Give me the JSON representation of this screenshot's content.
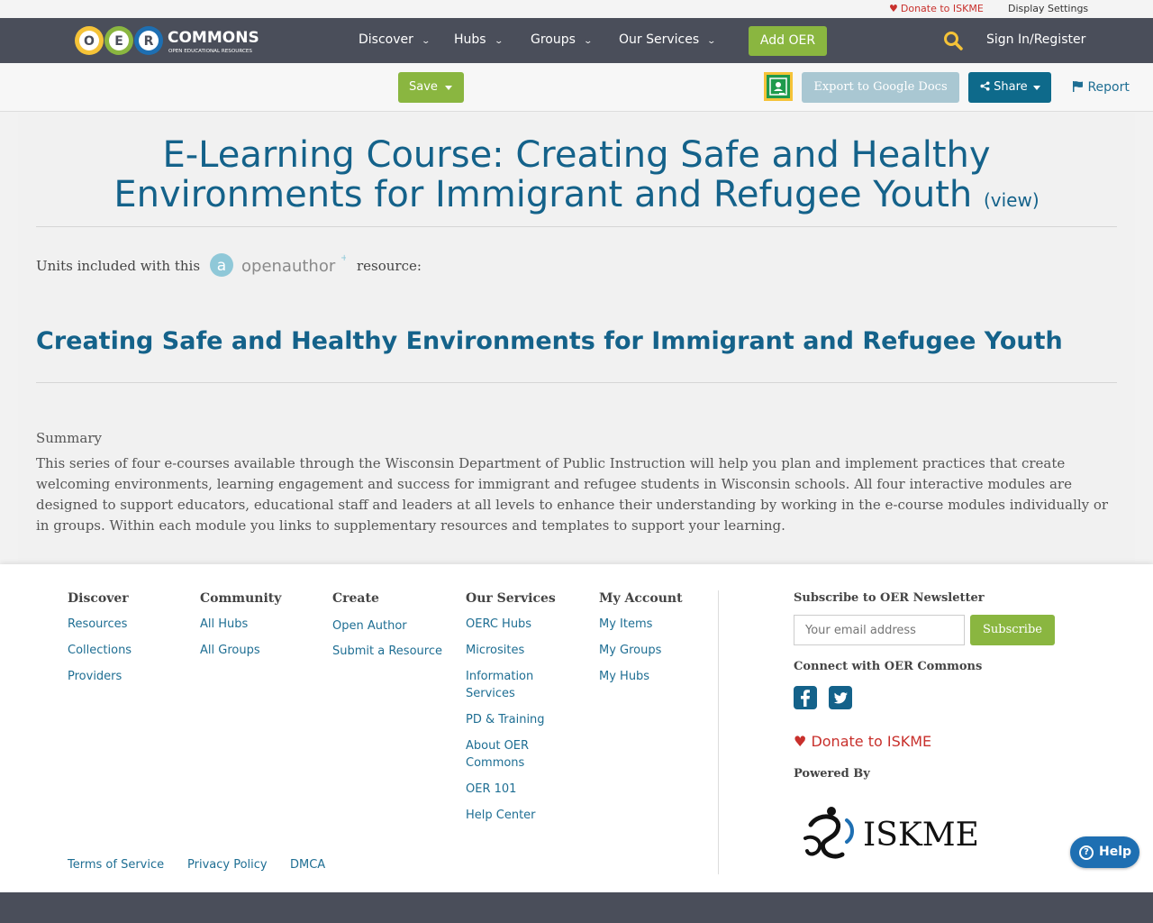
{
  "utility": {
    "donate": "Donate to ISKME",
    "display_settings": "Display Settings"
  },
  "nav": {
    "logo_letters": [
      "O",
      "E",
      "R"
    ],
    "logo_word": "COMMONS",
    "logo_tagline": "OPEN EDUCATIONAL RESOURCES",
    "items": [
      {
        "label": "Discover"
      },
      {
        "label": "Hubs"
      },
      {
        "label": "Groups"
      },
      {
        "label": "Our Services"
      }
    ],
    "add_oer": "Add OER",
    "sign_in": "Sign In/Register"
  },
  "toolbar": {
    "save": "Save",
    "export": "Export to Google Docs",
    "share": "Share",
    "report": "Report"
  },
  "main": {
    "title": "E-Learning Course: Creating Safe and Healthy Environments for Immigrant and Refugee Youth",
    "view_link": "(view)",
    "units_prefix": "Units included with this",
    "open_author_logo": "openauthor",
    "units_suffix": "resource:",
    "unit_title": "Creating Safe and Healthy Environments for Immigrant and Refugee Youth",
    "summary_label": "Summary",
    "summary_text": "This series of four e-courses available through the Wisconsin Department of Public Instruction will help you plan and implement practices that create welcoming environments, learning engagement and success for immigrant and refugee students in Wisconsin schools. All four interactive modules are designed to support educators, educational staff and leaders at all levels to enhance their understanding by working in the e-course modules individually or in groups. Within each module you links to supplementary resources and templates to support your learning."
  },
  "footer": {
    "columns": [
      {
        "heading": "Discover",
        "links": [
          "Resources",
          "Collections",
          "Providers"
        ]
      },
      {
        "heading": "Community",
        "links": [
          "All Hubs",
          "All Groups"
        ]
      },
      {
        "heading": "Create",
        "links": [
          "Open Author",
          "Submit a Resource"
        ]
      },
      {
        "heading": "Our Services",
        "links": [
          "OERC Hubs",
          "Microsites",
          "Information Services",
          "PD & Training",
          "About OER Commons",
          "OER 101",
          "Help Center"
        ]
      },
      {
        "heading": "My Account",
        "links": [
          "My Items",
          "My Groups",
          "My Hubs"
        ]
      }
    ],
    "legal": [
      "Terms of Service",
      "Privacy Policy",
      "DMCA"
    ],
    "newsletter_heading": "Subscribe to OER Newsletter",
    "email_placeholder": "Your email address",
    "subscribe": "Subscribe",
    "connect_heading": "Connect with OER Commons",
    "donate": "Donate to ISKME",
    "powered_by": "Powered By",
    "iskme_logo": "ISKME"
  },
  "help_button": "Help",
  "colors": {
    "nav_bg": "#4a4e5a",
    "accent_green": "#8ab640",
    "primary_blue": "#14628a",
    "donate_red": "#c8302c",
    "logo_o": "#f5c338",
    "logo_e": "#8ab640",
    "logo_r": "#1e6fb2"
  }
}
